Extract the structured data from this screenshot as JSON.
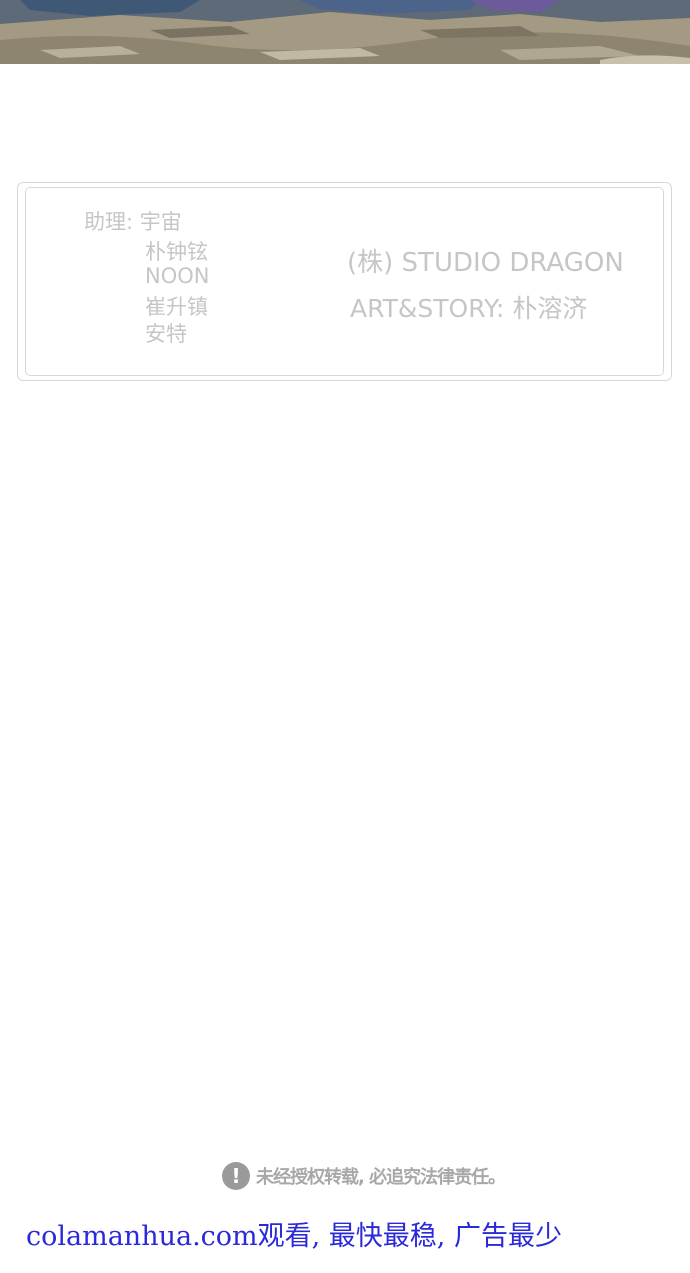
{
  "top_image": {
    "description_icon": "comic-panel-image"
  },
  "credits": {
    "assistants_label": "助理: 宇宙",
    "assistants": [
      "朴钟铉",
      "NOON",
      "崔升镇",
      "安特"
    ],
    "studio": "(株) STUDIO DRAGON",
    "art_story": "ART&STORY: 朴溶济"
  },
  "notice": {
    "icon": "exclamation-icon",
    "icon_glyph": "!",
    "text": "未经授权转载, 必追究法律责任。"
  },
  "promo": {
    "text": "colamanhua.com观看, 最快最稳, 广告最少"
  },
  "colors": {
    "credit_text": "#c6c6c6",
    "box_border": "#d8d8d8",
    "notice_icon": "#9a9a9a",
    "promo_text": "#2a2ad8"
  }
}
